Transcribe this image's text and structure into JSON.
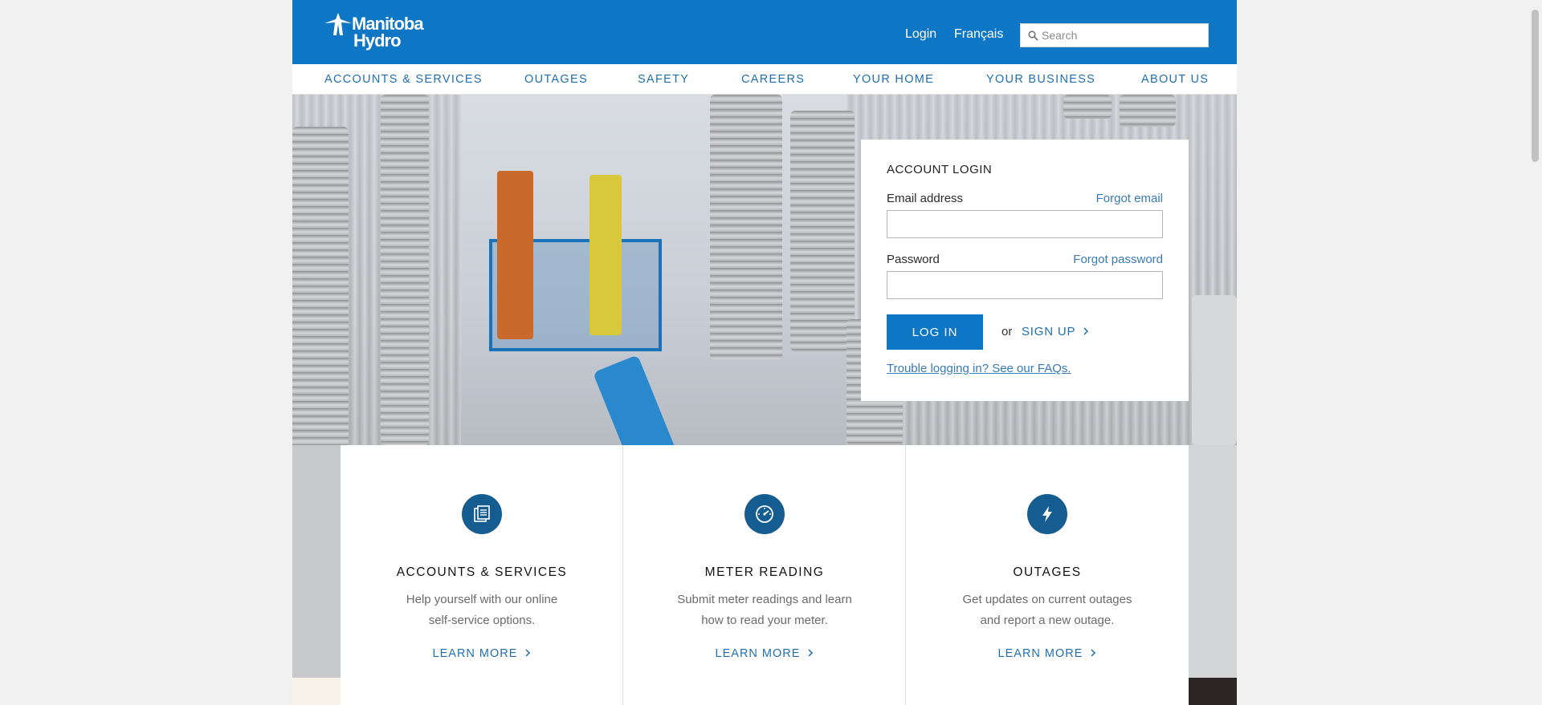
{
  "header": {
    "logo_line1": "Manitoba",
    "logo_line2": "Hydro",
    "login_link": "Login",
    "language_link": "Français",
    "search_placeholder": "Search"
  },
  "nav": {
    "items": [
      {
        "label": "ACCOUNTS & SERVICES"
      },
      {
        "label": "OUTAGES"
      },
      {
        "label": "SAFETY"
      },
      {
        "label": "CAREERS"
      },
      {
        "label": "YOUR HOME"
      },
      {
        "label": "YOUR BUSINESS"
      },
      {
        "label": "ABOUT US"
      }
    ]
  },
  "login": {
    "title": "ACCOUNT LOGIN",
    "email_label": "Email address",
    "forgot_email": "Forgot email",
    "password_label": "Password",
    "forgot_password": "Forgot password",
    "login_button": "LOG IN",
    "or_text": "or",
    "signup_link": "SIGN UP",
    "trouble_link": "Trouble logging in? See our FAQs."
  },
  "cards": [
    {
      "icon": "document-icon",
      "title": "ACCOUNTS & SERVICES",
      "desc_line1": "Help yourself with our online",
      "desc_line2": "self-service options.",
      "link": "LEARN MORE"
    },
    {
      "icon": "meter-icon",
      "title": "METER READING",
      "desc_line1": "Submit meter readings and learn",
      "desc_line2": "how to read your meter.",
      "link": "LEARN MORE"
    },
    {
      "icon": "lightning-icon",
      "title": "OUTAGES",
      "desc_line1": "Get updates on current outages",
      "desc_line2": "and report a new outage.",
      "link": "LEARN MORE"
    }
  ],
  "colors": {
    "brand_blue": "#0d76c5",
    "link_blue": "#1f6fb0",
    "icon_navy": "#155c91"
  }
}
